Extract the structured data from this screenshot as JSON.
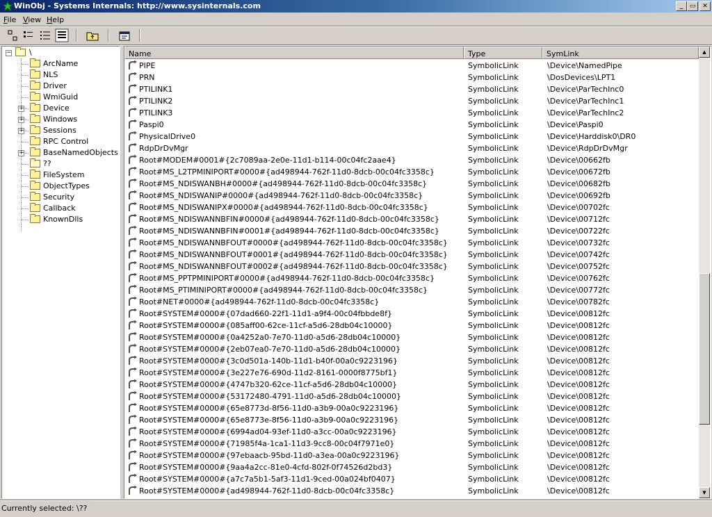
{
  "window": {
    "title": "WinObj - Systems Internals: http://www.sysinternals.com",
    "minimize_glyph": "_",
    "maximize_glyph": "▭",
    "close_glyph": "✕"
  },
  "menu": [
    {
      "label": "File",
      "key": "F"
    },
    {
      "label": "View",
      "key": "V"
    },
    {
      "label": "Help",
      "key": "H"
    }
  ],
  "toolbar": {
    "buttons": [
      "large-icons-view",
      "small-icons-view",
      "list-view",
      "details-view",
      "up-one-level",
      "properties"
    ]
  },
  "tree": {
    "root": "\\",
    "items": [
      {
        "label": "ArcName",
        "expandable": false
      },
      {
        "label": "NLS",
        "expandable": false
      },
      {
        "label": "Driver",
        "expandable": false
      },
      {
        "label": "WmiGuid",
        "expandable": false
      },
      {
        "label": "Device",
        "expandable": true
      },
      {
        "label": "Windows",
        "expandable": true
      },
      {
        "label": "Sessions",
        "expandable": true
      },
      {
        "label": "RPC Control",
        "expandable": false
      },
      {
        "label": "BaseNamedObjects",
        "expandable": true
      },
      {
        "label": "??",
        "expandable": false,
        "open": true
      },
      {
        "label": "FileSystem",
        "expandable": false
      },
      {
        "label": "ObjectTypes",
        "expandable": false
      },
      {
        "label": "Security",
        "expandable": false
      },
      {
        "label": "Callback",
        "expandable": false
      },
      {
        "label": "KnownDlls",
        "expandable": false
      }
    ]
  },
  "list": {
    "columns": [
      "Name",
      "Type",
      "SymLink"
    ],
    "rows": [
      [
        "PIPE",
        "SymbolicLink",
        "\\Device\\NamedPipe"
      ],
      [
        "PRN",
        "SymbolicLink",
        "\\DosDevices\\LPT1"
      ],
      [
        "PTILINK1",
        "SymbolicLink",
        "\\Device\\ParTechInc0"
      ],
      [
        "PTILINK2",
        "SymbolicLink",
        "\\Device\\ParTechInc1"
      ],
      [
        "PTILINK3",
        "SymbolicLink",
        "\\Device\\ParTechInc2"
      ],
      [
        "Paspi0",
        "SymbolicLink",
        "\\Device\\Paspi0"
      ],
      [
        "PhysicalDrive0",
        "SymbolicLink",
        "\\Device\\Harddisk0\\DR0"
      ],
      [
        "RdpDrDvMgr",
        "SymbolicLink",
        "\\Device\\RdpDrDvMgr"
      ],
      [
        "Root#MODEM#0001#{2c7089aa-2e0e-11d1-b114-00c04fc2aae4}",
        "SymbolicLink",
        "\\Device\\00662fb"
      ],
      [
        "Root#MS_L2TPMINIPORT#0000#{ad498944-762f-11d0-8dcb-00c04fc3358c}",
        "SymbolicLink",
        "\\Device\\00672fb"
      ],
      [
        "Root#MS_NDISWANBH#0000#{ad498944-762f-11d0-8dcb-00c04fc3358c}",
        "SymbolicLink",
        "\\Device\\00682fb"
      ],
      [
        "Root#MS_NDISWANIP#0000#{ad498944-762f-11d0-8dcb-00c04fc3358c}",
        "SymbolicLink",
        "\\Device\\00692fb"
      ],
      [
        "Root#MS_NDISWANIPX#0000#{ad498944-762f-11d0-8dcb-00c04fc3358c}",
        "SymbolicLink",
        "\\Device\\00702fc"
      ],
      [
        "Root#MS_NDISWANNBFIN#0000#{ad498944-762f-11d0-8dcb-00c04fc3358c}",
        "SymbolicLink",
        "\\Device\\00712fc"
      ],
      [
        "Root#MS_NDISWANNBFIN#0001#{ad498944-762f-11d0-8dcb-00c04fc3358c}",
        "SymbolicLink",
        "\\Device\\00722fc"
      ],
      [
        "Root#MS_NDISWANNBFOUT#0000#{ad498944-762f-11d0-8dcb-00c04fc3358c}",
        "SymbolicLink",
        "\\Device\\00732fc"
      ],
      [
        "Root#MS_NDISWANNBFOUT#0001#{ad498944-762f-11d0-8dcb-00c04fc3358c}",
        "SymbolicLink",
        "\\Device\\00742fc"
      ],
      [
        "Root#MS_NDISWANNBFOUT#0002#{ad498944-762f-11d0-8dcb-00c04fc3358c}",
        "SymbolicLink",
        "\\Device\\00752fc"
      ],
      [
        "Root#MS_PPTPMINIPORT#0000#{ad498944-762f-11d0-8dcb-00c04fc3358c}",
        "SymbolicLink",
        "\\Device\\00762fc"
      ],
      [
        "Root#MS_PTIMINIPORT#0000#{ad498944-762f-11d0-8dcb-00c04fc3358c}",
        "SymbolicLink",
        "\\Device\\00772fc"
      ],
      [
        "Root#NET#0000#{ad498944-762f-11d0-8dcb-00c04fc3358c}",
        "SymbolicLink",
        "\\Device\\00782fc"
      ],
      [
        "Root#SYSTEM#0000#{07dad660-22f1-11d1-a9f4-00c04fbbde8f}",
        "SymbolicLink",
        "\\Device\\00812fc"
      ],
      [
        "Root#SYSTEM#0000#{085aff00-62ce-11cf-a5d6-28db04c10000}",
        "SymbolicLink",
        "\\Device\\00812fc"
      ],
      [
        "Root#SYSTEM#0000#{0a4252a0-7e70-11d0-a5d6-28db04c10000}",
        "SymbolicLink",
        "\\Device\\00812fc"
      ],
      [
        "Root#SYSTEM#0000#{2eb07ea0-7e70-11d0-a5d6-28db04c10000}",
        "SymbolicLink",
        "\\Device\\00812fc"
      ],
      [
        "Root#SYSTEM#0000#{3c0d501a-140b-11d1-b40f-00a0c9223196}",
        "SymbolicLink",
        "\\Device\\00812fc"
      ],
      [
        "Root#SYSTEM#0000#{3e227e76-690d-11d2-8161-0000f8775bf1}",
        "SymbolicLink",
        "\\Device\\00812fc"
      ],
      [
        "Root#SYSTEM#0000#{4747b320-62ce-11cf-a5d6-28db04c10000}",
        "SymbolicLink",
        "\\Device\\00812fc"
      ],
      [
        "Root#SYSTEM#0000#{53172480-4791-11d0-a5d6-28db04c10000}",
        "SymbolicLink",
        "\\Device\\00812fc"
      ],
      [
        "Root#SYSTEM#0000#{65e8773d-8f56-11d0-a3b9-00a0c9223196}",
        "SymbolicLink",
        "\\Device\\00812fc"
      ],
      [
        "Root#SYSTEM#0000#{65e8773e-8f56-11d0-a3b9-00a0c9223196}",
        "SymbolicLink",
        "\\Device\\00812fc"
      ],
      [
        "Root#SYSTEM#0000#{6994ad04-93ef-11d0-a3cc-00a0c9223196}",
        "SymbolicLink",
        "\\Device\\00812fc"
      ],
      [
        "Root#SYSTEM#0000#{71985f4a-1ca1-11d3-9cc8-00c04f7971e0}",
        "SymbolicLink",
        "\\Device\\00812fc"
      ],
      [
        "Root#SYSTEM#0000#{97ebaacb-95bd-11d0-a3ea-00a0c9223196}",
        "SymbolicLink",
        "\\Device\\00812fc"
      ],
      [
        "Root#SYSTEM#0000#{9aa4a2cc-81e0-4cfd-802f-0f74526d2bd3}",
        "SymbolicLink",
        "\\Device\\00812fc"
      ],
      [
        "Root#SYSTEM#0000#{a7c7a5b1-5af3-11d1-9ced-00a024bf0407}",
        "SymbolicLink",
        "\\Device\\00812fc"
      ],
      [
        "Root#SYSTEM#0000#{ad498944-762f-11d0-8dcb-00c04fc3358c}",
        "SymbolicLink",
        "\\Device\\00812fc"
      ]
    ]
  },
  "scrollbar": {
    "up_glyph": "▲",
    "down_glyph": "▼"
  },
  "status": {
    "text": "Currently selected:  \\??"
  },
  "colors": {
    "title_start": "#0a246a",
    "title_end": "#a6caf0",
    "chrome": "#d4d0c8",
    "folder": "#fff1a0"
  }
}
